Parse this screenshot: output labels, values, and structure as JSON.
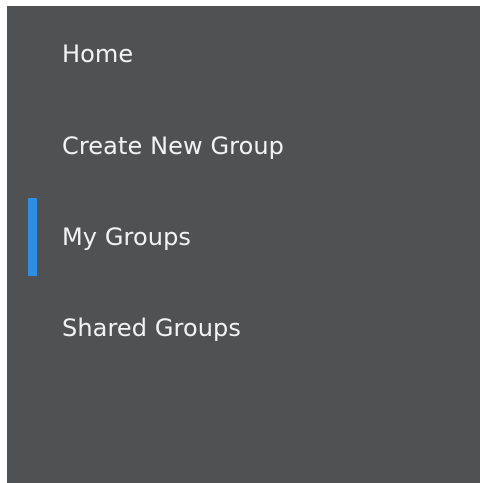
{
  "nav": {
    "items": [
      {
        "label": "Home",
        "active": false
      },
      {
        "label": "Create New Group",
        "active": false
      },
      {
        "label": "My Groups",
        "active": true
      },
      {
        "label": "Shared Groups",
        "active": false
      }
    ]
  },
  "colors": {
    "background": "#505153",
    "text": "#f2f2f2",
    "active_indicator": "#2f8de4"
  }
}
